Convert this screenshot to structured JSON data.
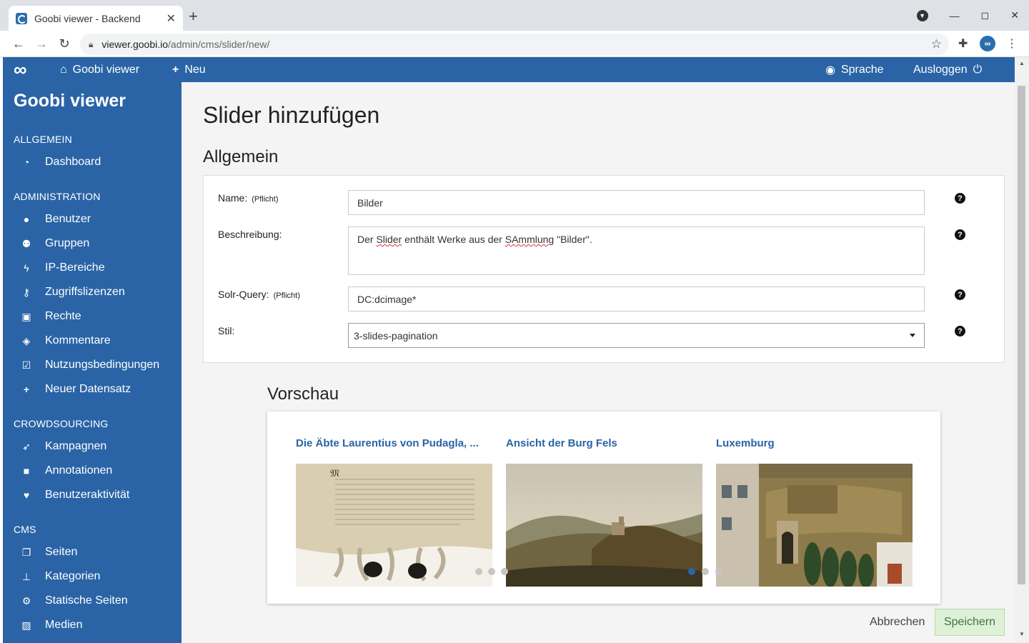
{
  "browser": {
    "tab_title": "Goobi viewer - Backend",
    "url_host": "viewer.goobi.io",
    "url_path": "/admin/cms/slider/new/"
  },
  "topbar": {
    "home_label": "Goobi viewer",
    "new_label": "Neu",
    "language_label": "Sprache",
    "logout_label": "Ausloggen"
  },
  "sidebar": {
    "brand": "Goobi viewer",
    "sections": {
      "general": "ALLGEMEIN",
      "admin": "ADMINISTRATION",
      "crowd": "CROWDSOURCING",
      "cms": "CMS"
    },
    "items": {
      "dashboard": "Dashboard",
      "users": "Benutzer",
      "groups": "Gruppen",
      "ip": "IP-Bereiche",
      "licenses": "Zugriffslizenzen",
      "rights": "Rechte",
      "comments": "Kommentare",
      "terms": "Nutzungsbedingungen",
      "newrecord": "Neuer Datensatz",
      "campaigns": "Kampagnen",
      "annotations": "Annotationen",
      "activity": "Benutzeraktivität",
      "pages": "Seiten",
      "categories": "Kategorien",
      "static": "Statische Seiten",
      "media": "Medien"
    }
  },
  "main": {
    "title": "Slider hinzufügen",
    "section_general": "Allgemein",
    "required": "(Pflicht)",
    "labels": {
      "name": "Name:",
      "description": "Beschreibung:",
      "query": "Solr-Query:",
      "style": "Stil:"
    },
    "values": {
      "name": "Bilder",
      "desc_1": "Der ",
      "desc_slider": "Slider",
      "desc_2": " enthält Werke aus der ",
      "desc_samm": "SAmmlung",
      "desc_3": " \"Bilder\".",
      "query": "DC:dcimage*",
      "style": "3-slides-pagination"
    },
    "preview_title": "Vorschau",
    "slides": [
      {
        "title": "Die Äbte Laurentius von Pudagla, ..."
      },
      {
        "title": "Ansicht der Burg Fels"
      },
      {
        "title": "Luxemburg"
      }
    ],
    "cancel_label": "Abbrechen",
    "save_label": "Speichern"
  },
  "icons": {
    "help": "?",
    "colors": {
      "primary": "#2a64a6",
      "save_bg": "#dff0d8",
      "save_text": "#3c763d"
    }
  }
}
